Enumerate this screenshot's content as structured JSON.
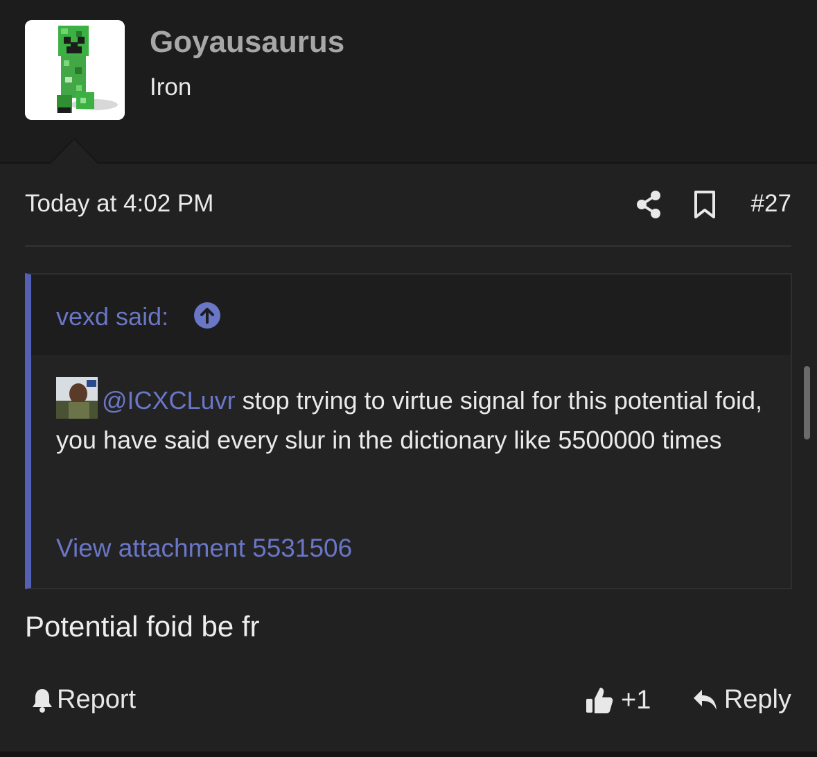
{
  "user": {
    "name": "Goyausaurus",
    "title": "Iron",
    "avatar_icon": "creeper-avatar"
  },
  "post": {
    "date": "Today at 4:02 PM",
    "number": "#27",
    "share_icon": "share-icon",
    "bookmark_icon": "bookmark-icon",
    "body": "Potential foid be fr"
  },
  "quote": {
    "author_said": "vexd said:",
    "jump_icon": "arrow-up-circle-icon",
    "mention": "@ICXCLuvr",
    "text": " stop trying to virtue signal for this potential foid, you have said every slur in the dictionary like 5500000 times",
    "attachment": "View attachment 5531506"
  },
  "actions": {
    "report": "Report",
    "like": "+1",
    "reply": "Reply"
  },
  "colors": {
    "background": "#212121",
    "header": "#1c1c1c",
    "link": "#6a76c6",
    "quote_border": "#5360b4"
  }
}
